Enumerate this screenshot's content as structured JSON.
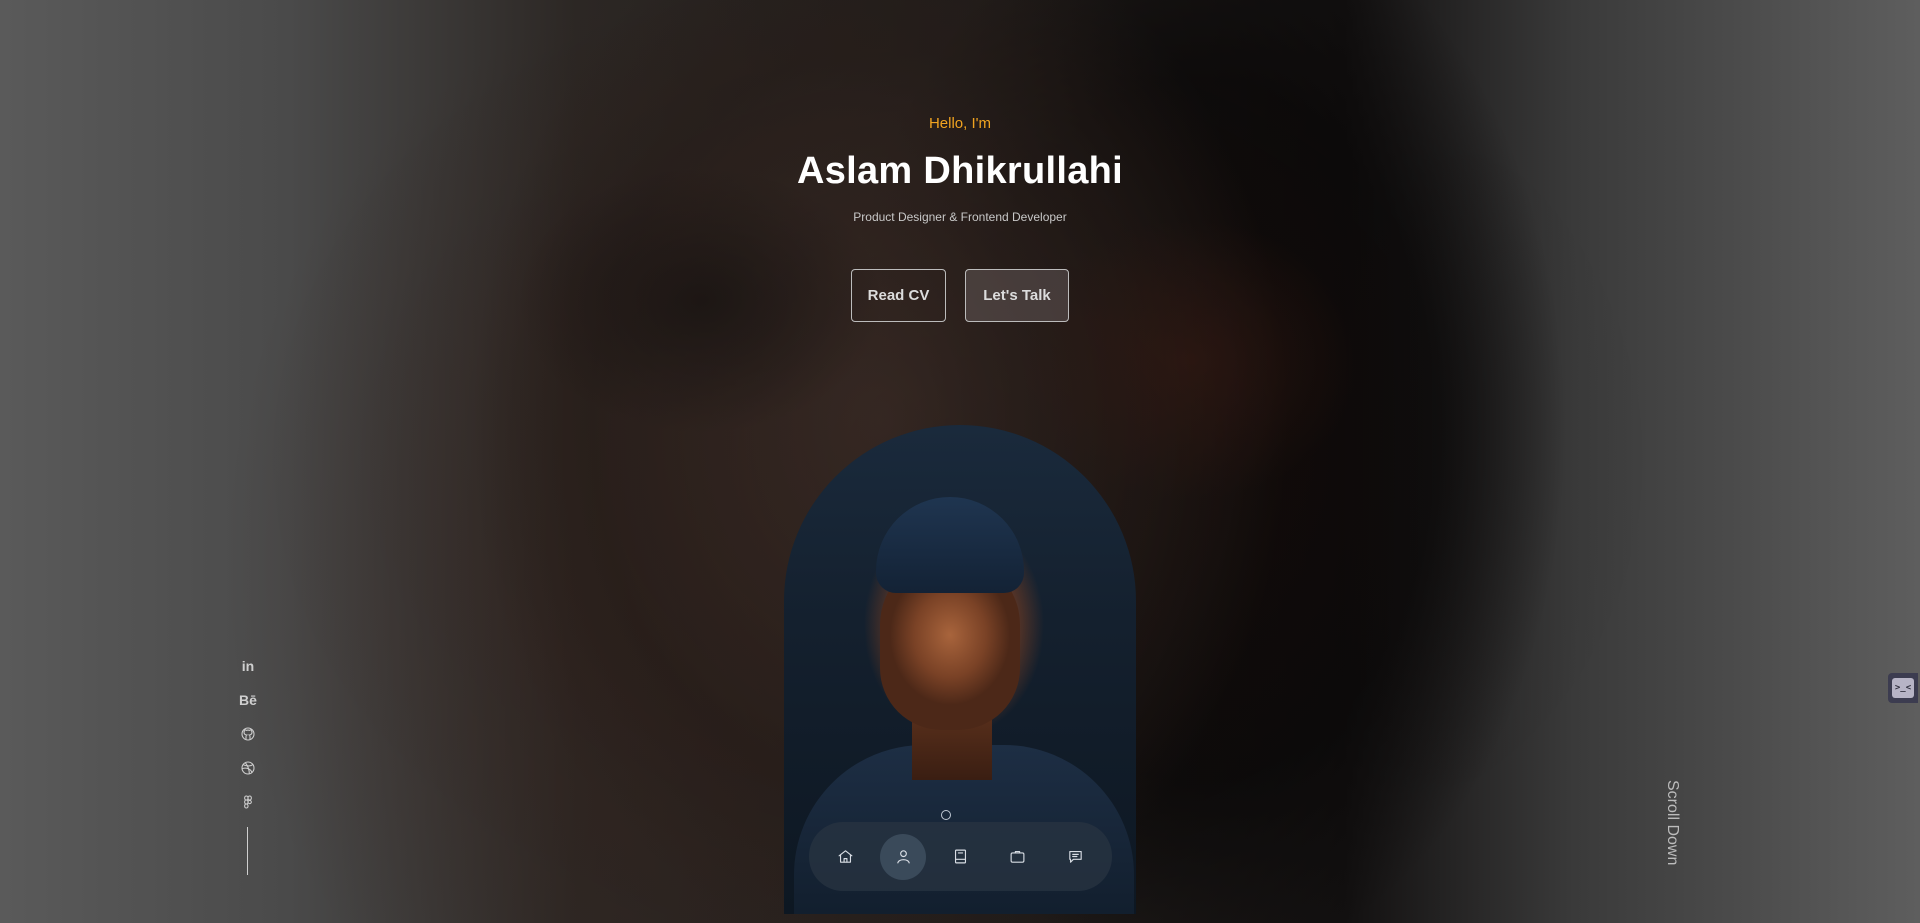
{
  "hero": {
    "greeting": "Hello, I'm",
    "name": "Aslam Dhikrullahi",
    "role": "Product Designer & Frontend Developer",
    "buttons": {
      "read_cv": "Read CV",
      "lets_talk": "Let's Talk"
    }
  },
  "colors": {
    "accent": "#f0a320",
    "text_primary": "#ffffff",
    "text_muted": "#c8c8c8"
  },
  "socials": [
    {
      "name": "linkedin",
      "label": "in"
    },
    {
      "name": "behance",
      "label": "Bē"
    },
    {
      "name": "github",
      "label": ""
    },
    {
      "name": "dribbble",
      "label": ""
    },
    {
      "name": "figma",
      "label": ""
    }
  ],
  "bottom_nav": [
    {
      "name": "home",
      "icon": "home-icon",
      "active": false
    },
    {
      "name": "about",
      "icon": "user-icon",
      "active": true
    },
    {
      "name": "experience",
      "icon": "book-icon",
      "active": false
    },
    {
      "name": "portfolio",
      "icon": "briefcase-icon",
      "active": false
    },
    {
      "name": "contact",
      "icon": "message-icon",
      "active": false
    }
  ],
  "scroll_down": "Scroll Down",
  "widget": {
    "glyph": ">_<"
  }
}
